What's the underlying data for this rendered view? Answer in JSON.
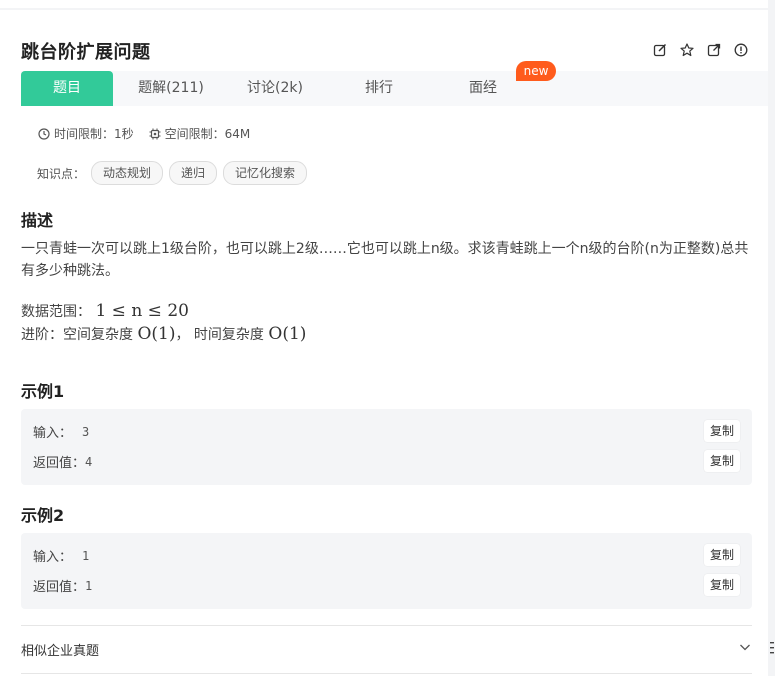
{
  "title": "跳台阶扩展问题",
  "toolbar": {
    "icons": [
      "edit-icon",
      "star-icon",
      "share-icon",
      "report-icon"
    ]
  },
  "tabs": [
    {
      "label": "题目",
      "active": true
    },
    {
      "label": "题解(211)",
      "active": false
    },
    {
      "label": "讨论(2k)",
      "active": false
    },
    {
      "label": "排行",
      "active": false
    },
    {
      "label": "面经",
      "active": false
    }
  ],
  "badge": "new",
  "limits": {
    "time": "时间限制：1秒",
    "space": "空间限制：64M"
  },
  "knowledge": {
    "label": "知识点：",
    "tags": [
      "动态规划",
      "递归",
      "记忆化搜索"
    ]
  },
  "description": {
    "heading": "描述",
    "text": "一只青蛙一次可以跳上1级台阶，也可以跳上2级……它也可以跳上n级。求该青蛙跳上一个n级的台阶(n为正整数)总共有多少种跳法。",
    "range_label": "数据范围：",
    "range_math": "1 ≤ n ≤ 20",
    "advanced_label": "进阶：空间复杂度",
    "advanced_math_space": "O(1)",
    "advanced_sep": "， 时间复杂度",
    "advanced_math_time": "O(1)"
  },
  "examples": [
    {
      "heading": "示例1",
      "input_label": "输入：",
      "input": "3",
      "output_label": "返回值：",
      "output": "4",
      "copy": "复制"
    },
    {
      "heading": "示例2",
      "input_label": "输入：",
      "input": "1",
      "output_label": "返回值：",
      "output": "1",
      "copy": "复制"
    }
  ],
  "similar": {
    "label": "相似企业真题"
  },
  "colors": {
    "accent": "#32ca99",
    "badge": "#ff5b1c"
  }
}
